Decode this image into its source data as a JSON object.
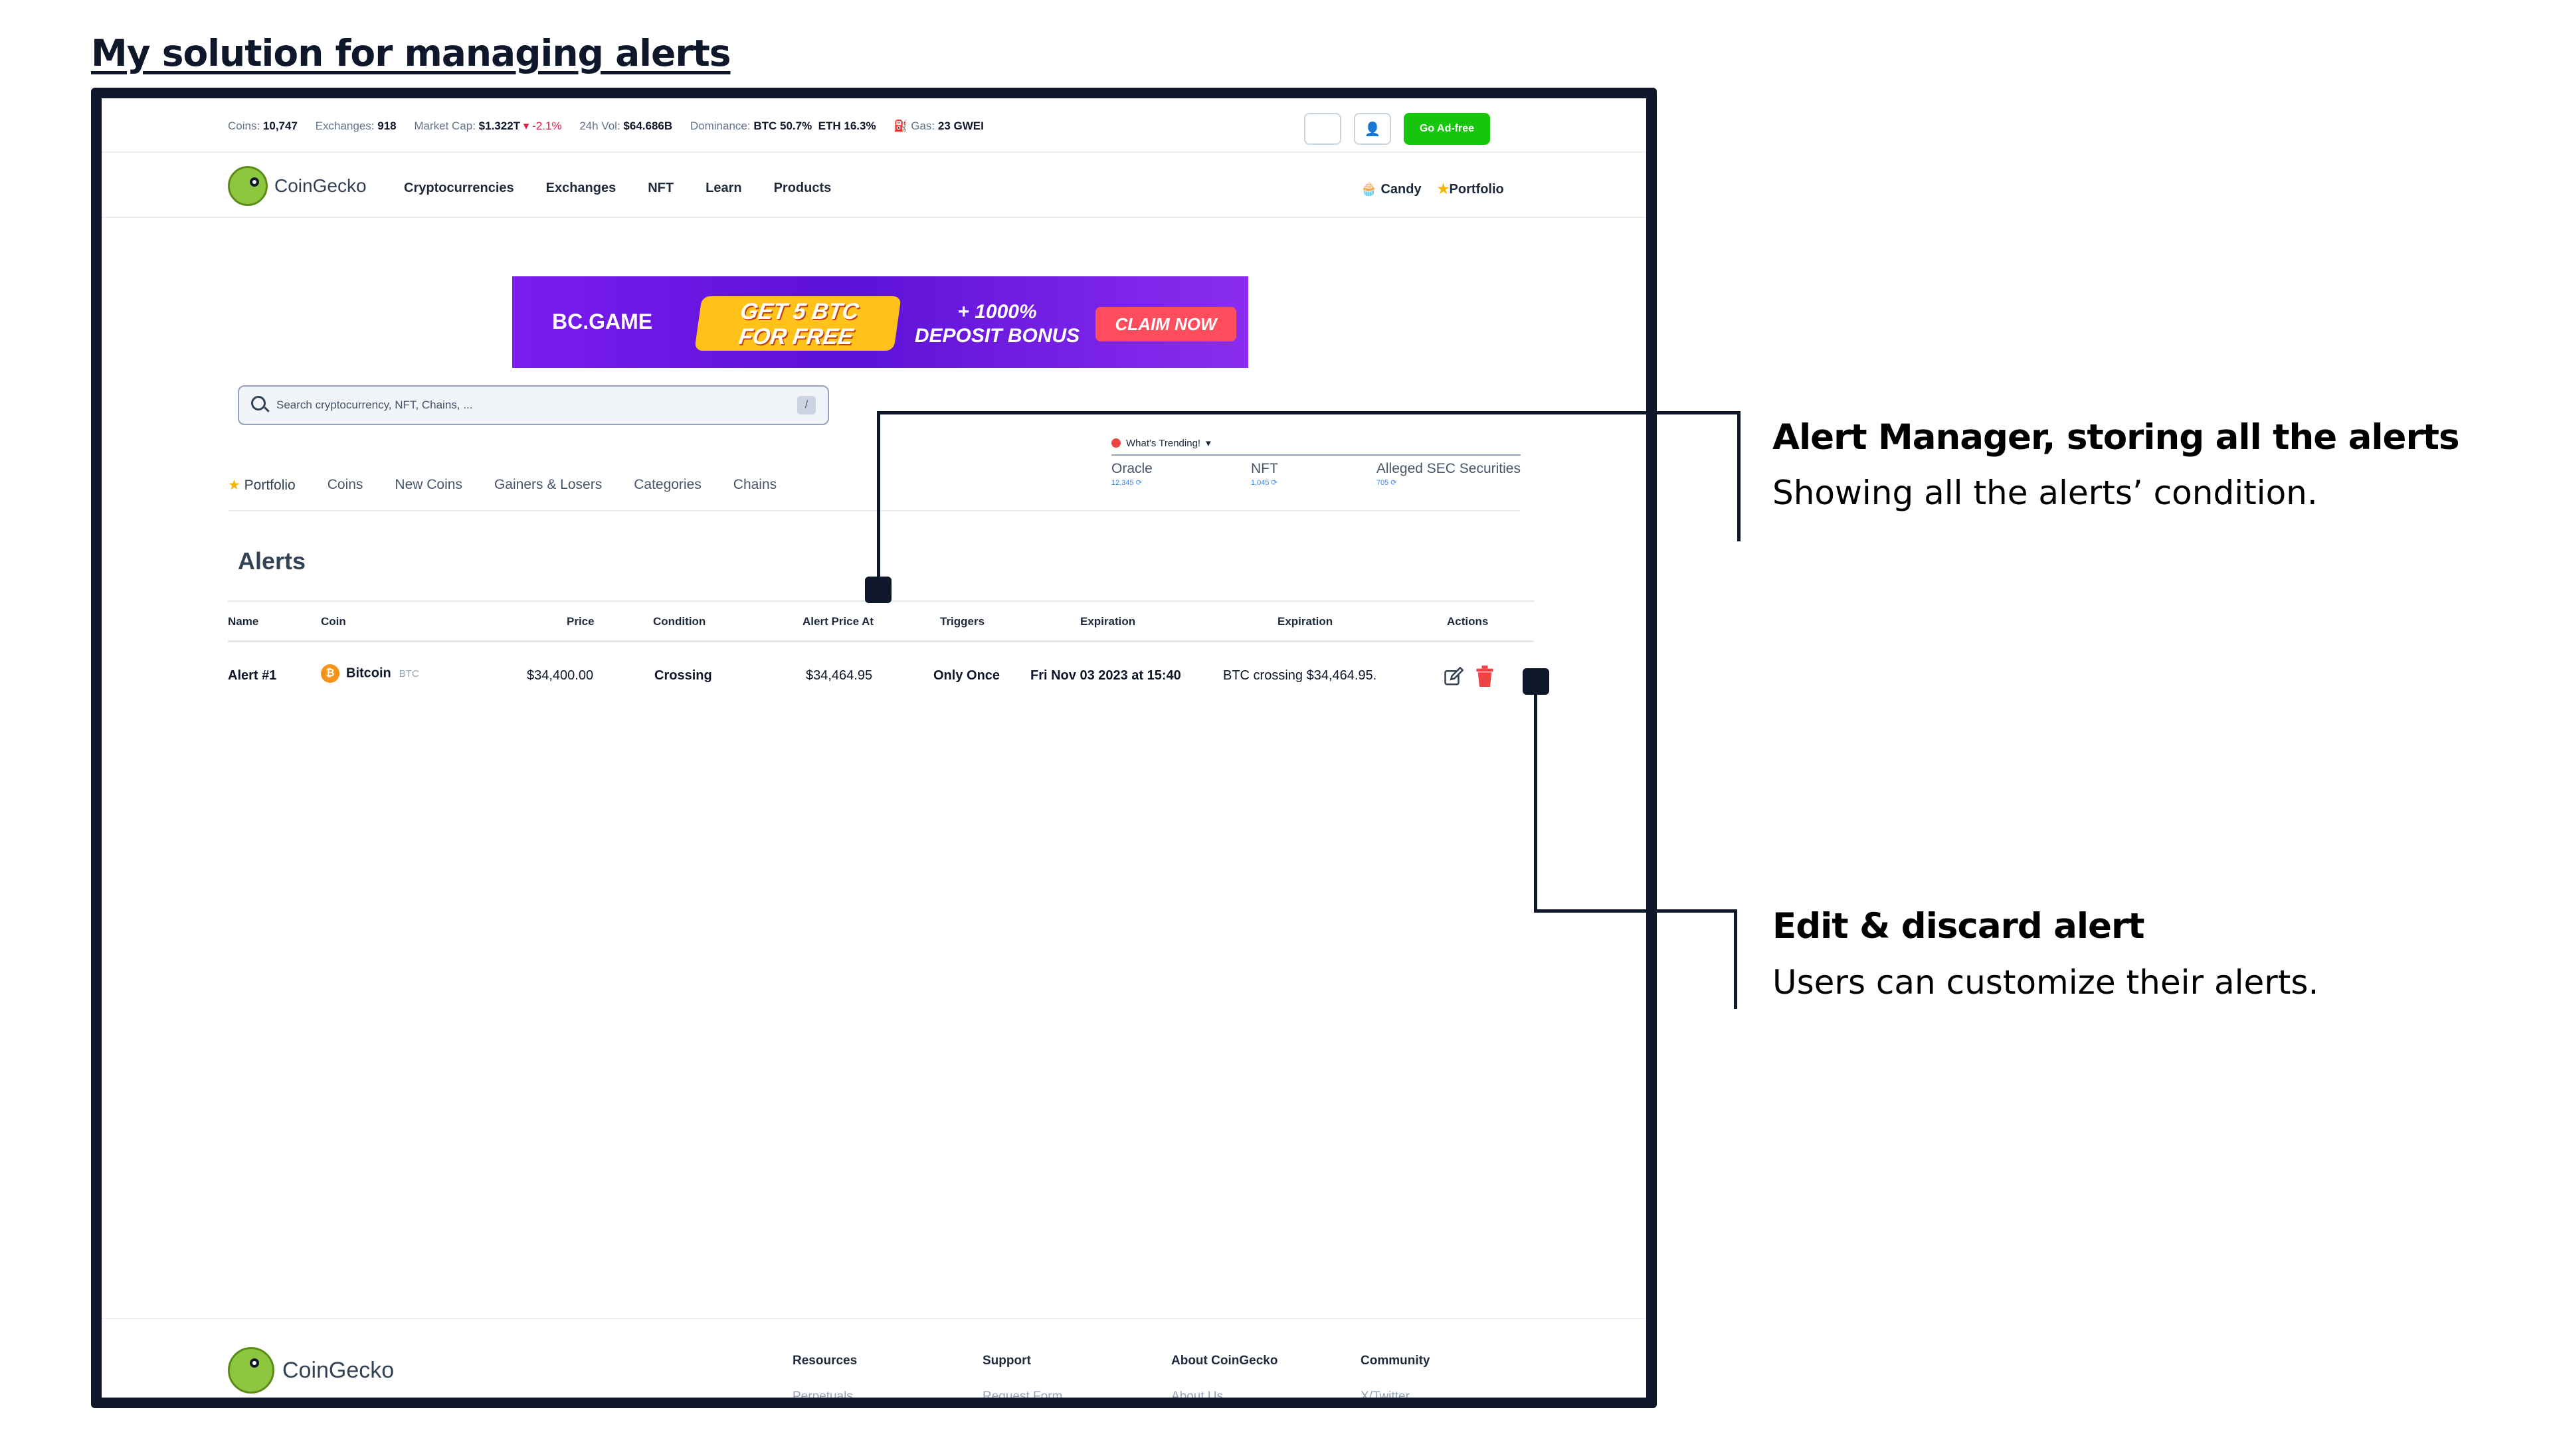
{
  "heading": "My solution for managing alerts",
  "stats": {
    "coins_label": "Coins:",
    "coins": "10,747",
    "exchanges_label": "Exchanges:",
    "exchanges": "918",
    "mcap_label": "Market Cap:",
    "mcap": "$1.322T",
    "mcap_change": "-2.1%",
    "vol_label": "24h Vol:",
    "vol": "$64.686B",
    "dom_label": "Dominance:",
    "dom_btc": "BTC 50.7%",
    "dom_eth": "ETH 16.3%",
    "gas_label": "Gas:",
    "gas": "23 GWEI"
  },
  "top_buttons": {
    "adfree": "Go Ad-free"
  },
  "nav": {
    "logo": "CoinGecko",
    "links": [
      "Cryptocurrencies",
      "Exchanges",
      "NFT",
      "Learn",
      "Products"
    ],
    "candy": "Candy",
    "portfolio": "Portfolio"
  },
  "ad": {
    "brand": "BC.GAME",
    "line1": "GET 5 BTC",
    "line2": "FOR FREE",
    "bonus1": "+ 1000%",
    "bonus2": "DEPOSIT BONUS",
    "cta": "CLAIM NOW"
  },
  "search": {
    "placeholder": "Search cryptocurrency, NFT, Chains, ...",
    "shortcut": "/"
  },
  "trending": {
    "title": "What's Trending!",
    "items": [
      {
        "name": "Oracle",
        "meta": "12,345 ⟳"
      },
      {
        "name": "NFT",
        "meta": "1,045 ⟳"
      },
      {
        "name": "Alleged SEC Securities",
        "meta": "705 ⟳"
      }
    ]
  },
  "subnav": [
    "Portfolio",
    "Coins",
    "New Coins",
    "Gainers & Losers",
    "Categories",
    "Chains"
  ],
  "alerts": {
    "title": "Alerts",
    "headers": [
      "Name",
      "Coin",
      "Price",
      "Condition",
      "Alert Price At",
      "Triggers",
      "Expiration",
      "Expiration",
      "Actions"
    ],
    "row": {
      "name": "Alert #1",
      "coin": "Bitcoin",
      "symbol": "BTC",
      "price": "$34,400.00",
      "condition": "Crossing",
      "alert_price": "$34,464.95",
      "triggers": "Only Once",
      "expiration": "Fri Nov 03 2023 at 15:40",
      "expiration2": "BTC crossing $34,464.95."
    }
  },
  "footer": {
    "logo": "CoinGecko",
    "cols": [
      {
        "title": "Resources",
        "first": "Perpetuals"
      },
      {
        "title": "Support",
        "first": "Request Form"
      },
      {
        "title": "About CoinGecko",
        "first": "About Us"
      },
      {
        "title": "Community",
        "first": "X/Twitter"
      }
    ]
  },
  "annotations": {
    "a1_title": "Alert Manager, storing all the alerts",
    "a1_sub": "Showing all the alerts’ condition.",
    "a2_title": "Edit & discard alert",
    "a2_sub": "Users can customize their alerts."
  },
  "colors": {
    "frame": "#0f172a",
    "adfree": "#16c60c",
    "negative": "#e11d48",
    "delete": "#ef4444"
  }
}
